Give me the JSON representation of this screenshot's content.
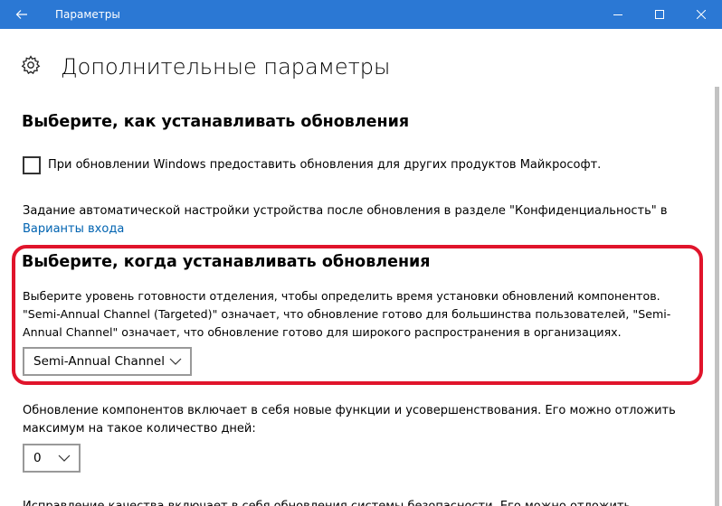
{
  "window": {
    "title": "Параметры",
    "accent": "#2b78d4"
  },
  "page": {
    "title": "Дополнительные параметры",
    "icon": "gear-icon"
  },
  "install_section": {
    "heading": "Выберите, как устанавливать обновления",
    "checkbox_label": "При обновлении Windows предоставить обновления для других продуктов Майкрософт.",
    "checkbox_checked": false,
    "auto_setup_text": "Задание автоматической настройки устройства после обновления в разделе \"Конфиденциальность\" в",
    "auto_setup_link": "Варианты входа"
  },
  "when_section": {
    "heading": "Выберите, когда устанавливать обновления",
    "description": "Выберите уровень готовности отделения, чтобы определить время установки обновлений компонентов. \"Semi-Annual Channel (Targeted)\" означает, что обновление готово для большинства пользователей, \"Semi-Annual Channel\" означает, что обновление готово для широкого распространения в организациях.",
    "channel_selected": "Semi-Annual Channel",
    "highlight_color": "#e0142b"
  },
  "feature_section": {
    "description": "Обновление компонентов включает в себя новые функции и усовершенствования. Его можно отложить максимум на такое количество дней:",
    "days_selected": "0",
    "next_text": "Исправление качества включает в себя обновления системы безопасности. Его можно отложить"
  }
}
